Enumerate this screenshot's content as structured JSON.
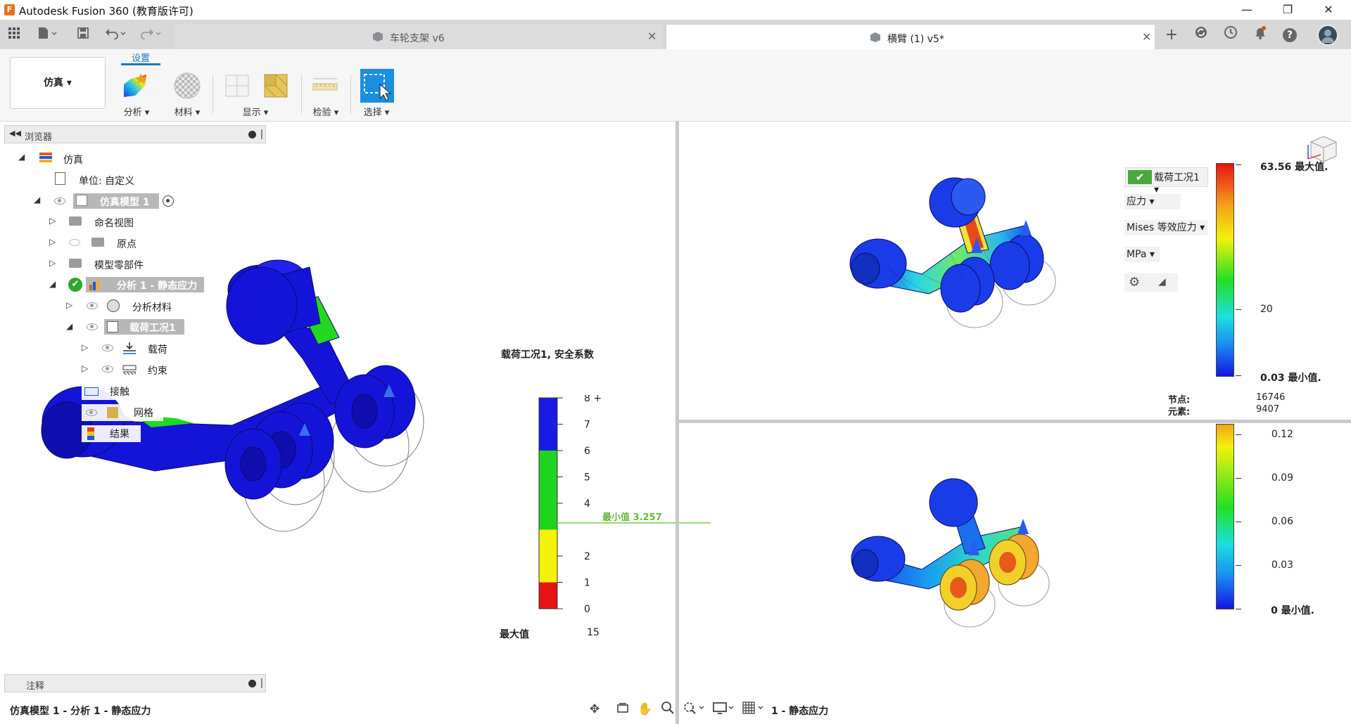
{
  "window": {
    "title": "Autodesk Fusion 360 (教育版许可)",
    "minimize": "—",
    "restore": "❐",
    "close": "✕"
  },
  "tabs": [
    {
      "label": "车轮支架 v6",
      "close": "✕",
      "active": false
    },
    {
      "label": "横臂 (1) v5*",
      "close": "✕",
      "active": true
    }
  ],
  "tabbar_icons": {
    "new_tab": "+",
    "help": "?"
  },
  "ribbon": {
    "workspace": "仿真 ▾",
    "setup_tab": "设置",
    "groups": [
      {
        "label": "分析 ▾"
      },
      {
        "label": "材料 ▾"
      },
      {
        "label": "显示 ▾"
      },
      {
        "label": "检验 ▾"
      },
      {
        "label": "选择 ▾"
      }
    ]
  },
  "browser": {
    "title": "浏览器",
    "items": [
      {
        "label": "仿真"
      },
      {
        "label": "单位: 自定义"
      },
      {
        "label": "仿真模型 1"
      },
      {
        "label": "命名视图"
      },
      {
        "label": "原点"
      },
      {
        "label": "模型零部件"
      },
      {
        "label": "分析 1 - 静态应力"
      },
      {
        "label": "分析材料"
      },
      {
        "label": "载荷工况1"
      },
      {
        "label": "载荷"
      },
      {
        "label": "约束"
      },
      {
        "label": "接触"
      },
      {
        "label": "网格"
      },
      {
        "label": "结果"
      }
    ]
  },
  "notes": {
    "title": "注释"
  },
  "safety_legend": {
    "title": "载荷工况1, 安全系数",
    "ticks": [
      "8 +",
      "7",
      "6",
      "5",
      "4",
      "2",
      "1",
      "0"
    ],
    "min_label": "最小值 3.257",
    "max_label": "最大值",
    "max_value": "15",
    "bands": [
      {
        "from": 6,
        "to": 8,
        "color": "#1a1ae6"
      },
      {
        "from": 3,
        "to": 6,
        "color": "#1fd41f"
      },
      {
        "from": 1,
        "to": 3,
        "color": "#f2f20a"
      },
      {
        "from": 0,
        "to": 1,
        "color": "#e61414"
      }
    ],
    "min_value": 3.257
  },
  "stress_panel": {
    "load_case": "载荷工况1 ▾",
    "result_type": "应力 ▾",
    "component": "Mises 等效应力 ▾",
    "unit": "MPa ▾",
    "max_label": "63.56 最大值.",
    "mid_label": "20",
    "min_label": "0.03 最小值.",
    "nodes_label": "节点:",
    "nodes_value": "16746",
    "elements_label": "元素:",
    "elements_value": "9407"
  },
  "displacement_panel": {
    "ticks": [
      "0.12",
      "0.09",
      "0.06",
      "0.03",
      "0 最小值."
    ]
  },
  "status": {
    "left": "仿真模型 1 - 分析 1 - 静态应力",
    "center": "1 - 静态应力"
  },
  "colors": {
    "accent": "#1a78c8",
    "model_blue": "#1a1ae6",
    "safety_green": "#1fd41f"
  }
}
